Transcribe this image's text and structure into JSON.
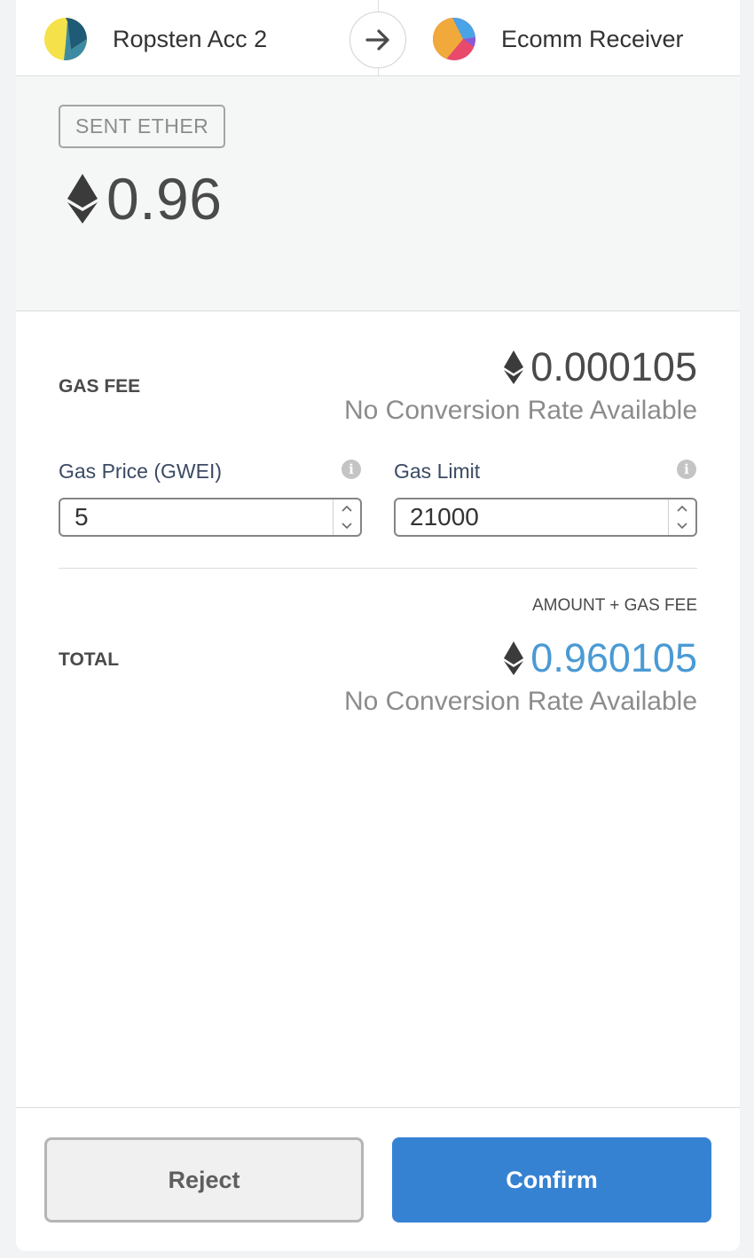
{
  "header": {
    "from_account": {
      "name": "Ropsten Acc 2",
      "icon": "identicon-yellow-teal"
    },
    "to_account": {
      "name": "Ecomm Receiver",
      "icon": "identicon-orange-pink-blue"
    },
    "arrow_icon": "arrow-right-icon"
  },
  "sent": {
    "badge": "SENT ETHER",
    "amount": "0.96",
    "currency_icon": "ether-icon"
  },
  "gas_fee": {
    "label": "GAS FEE",
    "amount": "0.000105",
    "conversion": "No Conversion Rate Available"
  },
  "gas_price": {
    "label": "Gas Price (GWEI)",
    "value": "5"
  },
  "gas_limit": {
    "label": "Gas Limit",
    "value": "21000"
  },
  "total": {
    "caption": "AMOUNT + GAS FEE",
    "label": "TOTAL",
    "amount": "0.960105",
    "conversion": "No Conversion Rate Available"
  },
  "footer": {
    "reject_label": "Reject",
    "confirm_label": "Confirm"
  },
  "colors": {
    "accent_blue": "#3682d2",
    "total_value_blue": "#4a9ad4",
    "identicon_from": [
      "#f5e14a",
      "#1f5a77",
      "#3d8ba3"
    ],
    "identicon_to": [
      "#f0a93a",
      "#e94a6b",
      "#4aa3e6"
    ]
  }
}
